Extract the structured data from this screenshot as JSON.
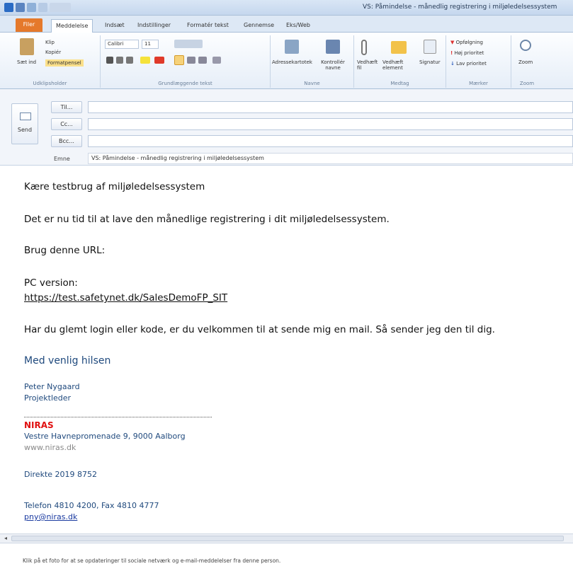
{
  "window": {
    "title": "VS: Påmindelse - månedlig registrering i miljøledelsessystem"
  },
  "tabs": [
    "Filer",
    "Meddelelse",
    "Indsæt",
    "Indstillinger",
    "Formatér tekst",
    "Gennemse",
    "Eks/Web"
  ],
  "ribbon": {
    "clipboard": {
      "paste": "Sæt ind",
      "cut": "Klip",
      "copy": "Kopiér",
      "format_painter": "Formatpensel",
      "label": "Udklipsholder"
    },
    "basic_text": {
      "font": "Calibri",
      "size": "11",
      "label": "Grundlæggende tekst"
    },
    "names": {
      "address_book": "Adressekartotek",
      "check_names": "Kontrollér navne",
      "label": "Navne"
    },
    "include": {
      "attach_file": "Vedhæft fil",
      "attach_item": "Vedhæft element",
      "signature": "Signatur",
      "label": "Medtag"
    },
    "tags": {
      "follow_up": "Opfølgning",
      "high": "Høj prioritet",
      "low": "Lav prioritet",
      "label": "Mærker"
    },
    "zoom": {
      "zoom": "Zoom",
      "label": "Zoom"
    }
  },
  "header": {
    "send_label": "Send",
    "to_label": "Til...",
    "cc_label": "Cc...",
    "bcc_label": "Bcc...",
    "subject_label": "Emne",
    "to_value": "",
    "cc_value": "",
    "bcc_value": "",
    "subject_value": "VS: Påmindelse - månedlig registrering i miljøledelsessystem"
  },
  "body": {
    "greeting": "Kære testbrug af miljøledelsessystem",
    "line1": "Det er nu tid til at lave den månedlige registrering i dit miljøledelsessystem.",
    "line2": "Brug denne URL:",
    "pc_label": "PC version:",
    "url": "https://test.safetynet.dk/SalesDemoFP_SIT",
    "line3": "Har du glemt login eller kode, er du velkommen til at sende mig en mail. Så sender jeg den til dig."
  },
  "signature": {
    "closing": "Med venlig hilsen",
    "name": "Peter Nygaard",
    "role": "Projektleder",
    "company": "NIRAS",
    "address": "Vestre Havnepromenade 9, 9000 Aalborg",
    "web": "www.niras.dk",
    "direct": "Direkte 2019 8752",
    "phone": "Telefon 4810 4200, Fax 4810 4777",
    "email": "pny@niras.dk"
  },
  "status": {
    "text": "Klik på et foto for at se opdateringer til sociale netværk og e-mail-meddelelser fra denne person."
  },
  "colors": {
    "accent": "#e5792b",
    "signature": "#1f497d",
    "brand": "#e01010"
  }
}
